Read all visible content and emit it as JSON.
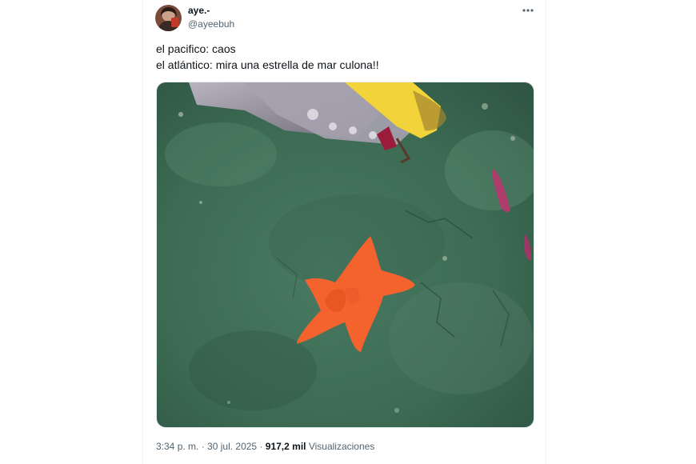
{
  "tweet": {
    "author": {
      "display_name": "aye.-",
      "handle": "@ayeebuh"
    },
    "text_lines": [
      "el pacifico: caos",
      "el atlántico: mira una estrella de mar culona!!"
    ],
    "meta": {
      "time": "3:34 p. m.",
      "separator": " · ",
      "date": "30 jul. 2025",
      "views_count": "917,2 mil",
      "views_label": "Visualizaciones"
    }
  },
  "colors": {
    "text_primary": "#0f1419",
    "text_secondary": "#536471",
    "seafloor": "#3f6b55",
    "starfish": "#f4622e",
    "robot_arm": "#9a96a3",
    "claw_yellow": "#f3d33a"
  },
  "icons": {
    "more": "more-horizontal-icon"
  }
}
